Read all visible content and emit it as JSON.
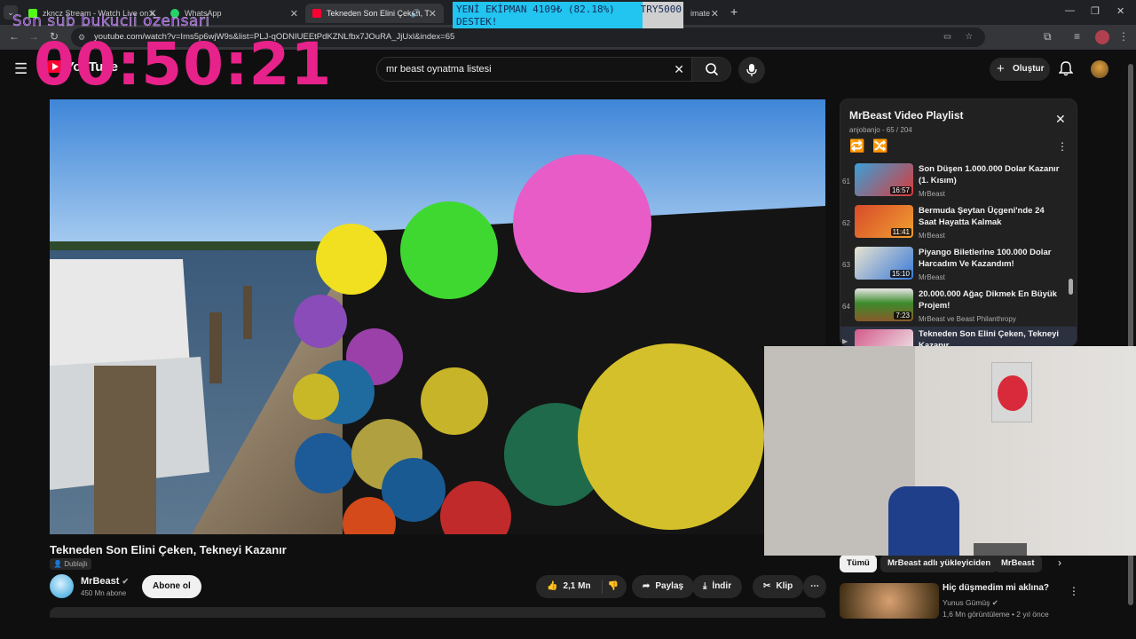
{
  "browser": {
    "tabs": [
      {
        "label": "zkncz Stream - Watch Live on K",
        "icon": "kick-icon",
        "color": "#53fc18"
      },
      {
        "label": "WhatsApp",
        "icon": "whatsapp-icon",
        "color": "#25d366"
      },
      {
        "label": "Tekneden Son Elini Çeken, T",
        "icon": "youtube-icon",
        "color": "#ff0033"
      },
      {
        "label": "imate",
        "icon": "tab-icon",
        "color": "#888888"
      }
    ],
    "url": "youtube.com/watch?v=Ims5p6wjW9s&list=PLJ-qODNIUEEtPdKZNLfbx7JOuRA_JjUxl&index=65"
  },
  "overlay": {
    "caption": "Son sub bukucii ozensari",
    "timer": "00:50:21",
    "donation": {
      "line1": "YENİ EKİPMAN 4109₺ (82.18%)",
      "line2": "DESTEK!",
      "goal": "TRY5000",
      "progress": 0.8218
    }
  },
  "youtube": {
    "logo": "YouTube",
    "region": "TR",
    "search_value": "mr beast oynatma listesi",
    "create_label": "Oluştur",
    "video": {
      "title": "Tekneden Son Elini Çeken, Tekneyi Kazanır",
      "dub_badge": "Dublajlı",
      "channel": "MrBeast",
      "subscribers": "450 Mn abone",
      "subscribe_label": "Abone ol",
      "likes": "2,1 Mn",
      "share_label": "Paylaş",
      "download_label": "İndir",
      "clip_label": "Klip"
    },
    "playlist": {
      "title": "MrBeast Video Playlist",
      "meta": "anjobanjo - 65 / 204",
      "items": [
        {
          "num": "61",
          "title": "Son Düşen 1.000.000 Dolar Kazanır (1. Kısım)",
          "channel": "MrBeast",
          "duration": "16:57",
          "color": "#3aa0d8"
        },
        {
          "num": "62",
          "title": "Bermuda Şeytan Üçgeni'nde 24 Saat Hayatta Kalmak",
          "channel": "MrBeast",
          "duration": "11:41",
          "color": "#d84a2a"
        },
        {
          "num": "63",
          "title": "Piyango Biletlerine 100.000 Dolar Harcadım Ve Kazandım!",
          "channel": "MrBeast",
          "duration": "15:10",
          "color": "#e8e3d0"
        },
        {
          "num": "64",
          "title": "20.000.000 Ağaç Dikmek En Büyük Projem!",
          "channel": "MrBeast ve Beast Philanthropy",
          "duration": "7:23",
          "color": "#3c8a2a"
        },
        {
          "num": "",
          "title": "Tekneden Son Elini Çeken, Tekneyi Kazanır",
          "channel": "",
          "duration": "",
          "color": "#d45a8a"
        }
      ]
    },
    "chips": [
      "Tümü",
      "MrBeast adlı yükleyiciden",
      "MrBeast"
    ],
    "recommendation": {
      "title": "Hiç düşmedim mi aklına?",
      "channel": "Yunus Gümüş",
      "meta": "1,6 Mn görüntüleme • 2 yıl önce"
    }
  }
}
